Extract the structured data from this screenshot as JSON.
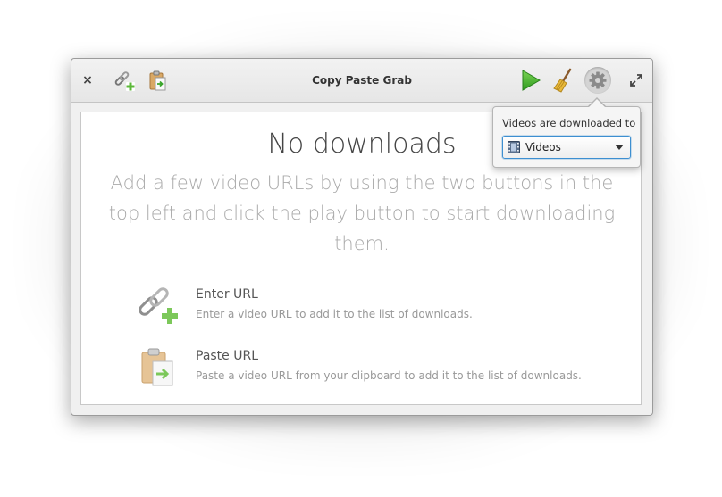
{
  "window": {
    "title": "Copy Paste Grab"
  },
  "toolbar": {
    "close_label": "×",
    "icons": {
      "close": "close-icon",
      "enter_url": "link-add-icon",
      "paste_url": "clipboard-paste-icon",
      "start": "play-icon",
      "clear": "broom-icon",
      "settings": "gear-icon",
      "maximize": "maximize-icon"
    }
  },
  "empty_state": {
    "heading": "No downloads",
    "description": "Add a few video URLs by using the two buttons in the top left and click the play button to start downloading them."
  },
  "actions": [
    {
      "title": "Enter URL",
      "description": "Enter a video URL to add it to the list of downloads.",
      "icon": "link-add-icon"
    },
    {
      "title": "Paste URL",
      "description": "Paste a video URL from your clipboard to add it to the list of downloads.",
      "icon": "clipboard-paste-icon"
    }
  ],
  "settings_popover": {
    "label": "Videos are downloaded to",
    "folder_value": "Videos",
    "folder_icon": "film-icon"
  },
  "colors": {
    "accent": "#3d8fd1",
    "play_green": "#3aa52b"
  }
}
